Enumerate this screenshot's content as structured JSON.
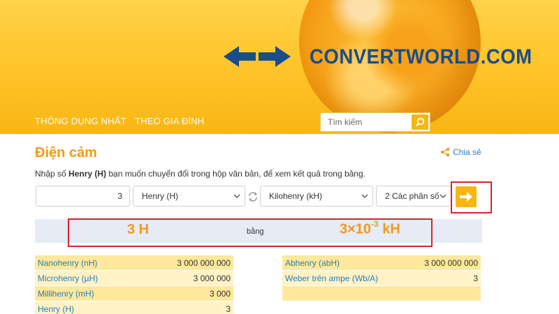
{
  "brand": {
    "logo_text": "CONVERTWORLD.COM"
  },
  "nav": {
    "items": [
      "THÔNG DỤNG NHẤT",
      "THEO GIA ĐÌNH"
    ]
  },
  "search": {
    "placeholder": "Tìm kiếm"
  },
  "page": {
    "title": "Điện cảm",
    "share": "Chia sẻ",
    "instruction_prefix": "Nhập số ",
    "instruction_bold": "Henry (H)",
    "instruction_suffix": " bạn muốn chuyển đổi trong hộp văn bản, để xem kết quả trong bảng."
  },
  "converter": {
    "value": "3",
    "from_unit": "Henry (H)",
    "to_unit": "Kilohenry (kH)",
    "precision": "2 Các phân số"
  },
  "result": {
    "from": "3 H",
    "equals": "bằng",
    "to_base": "3×10",
    "to_exp": "-3",
    "to_unit": " kH"
  },
  "table_left": [
    {
      "name": "Nanohenry (nH)",
      "value": "3 000 000 000"
    },
    {
      "name": "Microhenry (µH)",
      "value": "3 000 000"
    },
    {
      "name": "Millihenry (mH)",
      "value": "3 000"
    },
    {
      "name": "Henry (H)",
      "value": "3"
    }
  ],
  "table_right": [
    {
      "name": "Abhenry (abH)",
      "value": "3 000 000 000"
    },
    {
      "name": "Weber trên ampe (Wb/A)",
      "value": "3"
    },
    {
      "name": "",
      "value": ""
    }
  ],
  "colors": {
    "header": "#f7b614",
    "accent": "#f29a18",
    "link": "#2a7bbf",
    "highlight": "#d8232a",
    "logo": "#1a4d8a"
  },
  "icons": [
    "arrows-logo-icon",
    "search-icon",
    "share-icon",
    "swap-icon",
    "chevron-down-icon",
    "arrow-right-icon"
  ]
}
